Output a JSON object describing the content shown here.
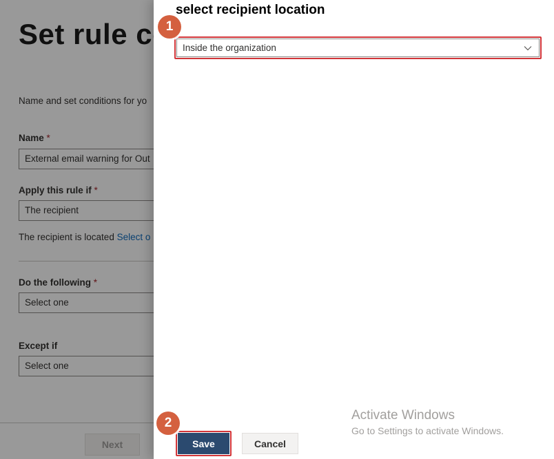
{
  "background_page": {
    "title": "Set rule co",
    "description": "Name and set conditions for yo",
    "name_label": "Name",
    "name_required": "*",
    "name_value": "External email warning for Out",
    "apply_label": "Apply this rule if",
    "apply_required": "*",
    "apply_value": "The recipient",
    "located_text": "The recipient is located",
    "located_link": "Select o",
    "do_label": "Do the following",
    "do_required": "*",
    "do_value": "Select one",
    "except_label": "Except if",
    "except_value": "Select one",
    "next_label": "Next"
  },
  "panel": {
    "title": "select recipient location",
    "location_select_value": "Inside the organization",
    "save_label": "Save",
    "cancel_label": "Cancel"
  },
  "annotations": {
    "step1": "1",
    "step2": "2",
    "badge_color": "#d4603f",
    "highlight_color": "#d13438"
  },
  "watermark": {
    "title": "Activate Windows",
    "subtitle": "Go to Settings to activate Windows."
  },
  "colors": {
    "primary_button": "#2b4a6f",
    "link": "#0f6cbd"
  }
}
